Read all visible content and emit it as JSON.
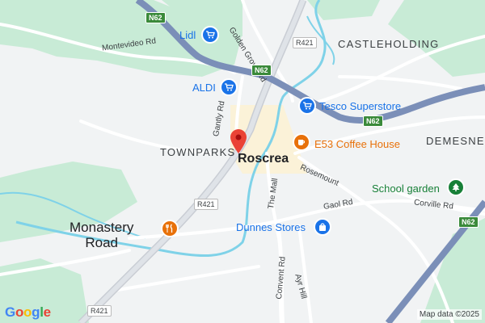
{
  "map": {
    "areas": {
      "castleholding": "CASTLEHOLDING",
      "townparks": "TOWNPARKS",
      "demesne": "DEMESNE"
    },
    "town": "Roscrea",
    "locality": {
      "line1": "Monastery",
      "line2": "Road"
    },
    "roads": {
      "montevideo": "Montevideo Rd",
      "golden_grove": "Golden Grove Rd",
      "gantly": "Gantly Rd",
      "the_mall": "The Mall",
      "rosemount": "Rosemount",
      "gaol": "Gaol Rd",
      "corville": "Corville Rd",
      "convent": "Convent Rd",
      "ayr_hill": "Ayr Hill"
    },
    "shields": {
      "n62": "N62",
      "r421": "R421"
    },
    "pois": {
      "lidl": {
        "name": "Lidl",
        "icon": "shopping-cart-icon"
      },
      "aldi": {
        "name": "ALDI",
        "icon": "shopping-cart-icon"
      },
      "tesco": {
        "name": "Tesco Superstore",
        "icon": "shopping-cart-icon"
      },
      "coffee": {
        "name": "E53 Coffee House",
        "icon": "coffee-cup-icon"
      },
      "school_garden": {
        "name": "School garden",
        "icon": "tree-icon"
      },
      "dunnes": {
        "name": "Dunnes Stores",
        "icon": "shopping-bag-icon"
      },
      "restaurant": {
        "icon": "fork-knife-icon"
      }
    },
    "colors": {
      "background": "#f1f3f4",
      "park": "#c8ebd6",
      "road": "#ffffff",
      "national_road": "#7b8fb8",
      "water": "#7fd2e8",
      "shop_blue": "#1a73e8",
      "food_orange": "#e8710a",
      "park_green": "#188038",
      "marker_red": "#ea4335"
    }
  },
  "footer": {
    "logo": "Google",
    "attribution": "Map data ©2025"
  }
}
